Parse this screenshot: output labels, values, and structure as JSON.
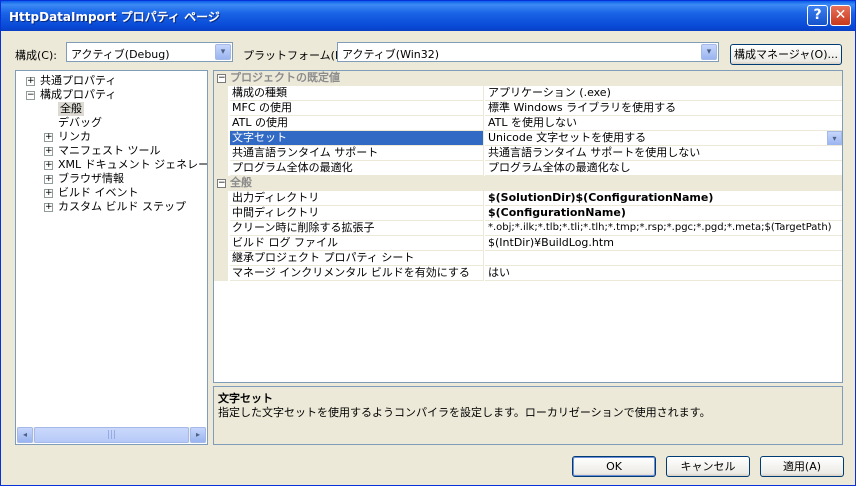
{
  "window": {
    "title": "HttpDataImport プロパティ ページ",
    "help": "?",
    "close": "✕"
  },
  "toolbar": {
    "config_label": "構成(C):",
    "config_value": "アクティブ(Debug)",
    "platform_label": "プラットフォーム(P):",
    "platform_value": "アクティブ(Win32)",
    "manager_button": "構成マネージャ(O)..."
  },
  "tree": {
    "items": [
      {
        "label": "共通プロパティ",
        "expander": "+"
      },
      {
        "label": "構成プロパティ",
        "expander": "−"
      },
      {
        "label": "全般"
      },
      {
        "label": "デバッグ"
      },
      {
        "label": "リンカ",
        "expander": "+"
      },
      {
        "label": "マニフェスト ツール",
        "expander": "+"
      },
      {
        "label": "XML ドキュメント ジェネレータ",
        "expander": "+"
      },
      {
        "label": "ブラウザ情報",
        "expander": "+"
      },
      {
        "label": "ビルド イベント",
        "expander": "+"
      },
      {
        "label": "カスタム ビルド ステップ",
        "expander": "+"
      }
    ]
  },
  "grid": {
    "categories": [
      {
        "title": "プロジェクトの既定値",
        "toggle": "−",
        "rows": [
          {
            "name": "構成の種類",
            "value": "アプリケーション (.exe)"
          },
          {
            "name": "MFC の使用",
            "value": "標準 Windows ライブラリを使用する"
          },
          {
            "name": "ATL の使用",
            "value": "ATL を使用しない"
          },
          {
            "name": "文字セット",
            "value": "Unicode 文字セットを使用する"
          },
          {
            "name": "共通言語ランタイム サポート",
            "value": "共通言語ランタイム サポートを使用しない"
          },
          {
            "name": "プログラム全体の最適化",
            "value": "プログラム全体の最適化なし"
          }
        ]
      },
      {
        "title": "全般",
        "toggle": "−",
        "rows": [
          {
            "name": "出力ディレクトリ",
            "value": "$(SolutionDir)$(ConfigurationName)"
          },
          {
            "name": "中間ディレクトリ",
            "value": "$(ConfigurationName)"
          },
          {
            "name": "クリーン時に削除する拡張子",
            "value": "*.obj;*.ilk;*.tlb;*.tli;*.tlh;*.tmp;*.rsp;*.pgc;*.pgd;*.meta;$(TargetPath)"
          },
          {
            "name": "ビルド ログ ファイル",
            "value": "$(IntDir)¥BuildLog.htm"
          },
          {
            "name": "継承プロジェクト プロパティ シート",
            "value": ""
          },
          {
            "name": "マネージ インクリメンタル ビルドを有効にする",
            "value": "はい"
          }
        ]
      }
    ]
  },
  "description": {
    "title": "文字セット",
    "text": "指定した文字セットを使用するようコンパイラを設定します。ローカリゼーションで使用されます。"
  },
  "buttons": {
    "ok": "OK",
    "cancel": "キャンセル",
    "apply": "適用(A)"
  },
  "icons": {
    "dropdown": "▾",
    "scroll_left": "◂",
    "scroll_right": "▸",
    "thumb_grip": "|||"
  }
}
